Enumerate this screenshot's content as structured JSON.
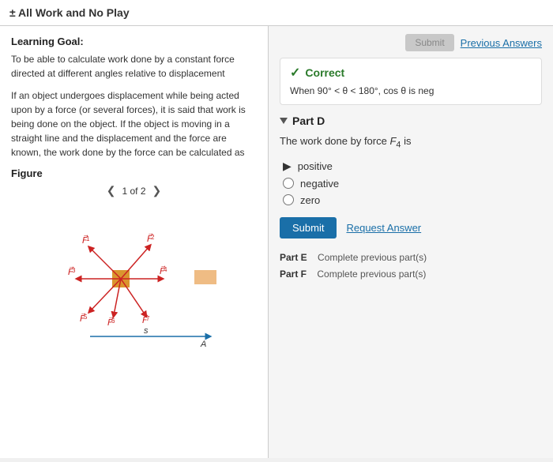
{
  "topBar": {
    "title": "± All Work and No Play"
  },
  "leftPanel": {
    "learningGoal": {
      "title": "Learning Goal:",
      "paragraph1": "To be able to calculate work done by a constant force directed at different angles relative to displacement",
      "paragraph2": "If an object undergoes displacement while being acted upon by a force (or several forces), it is said that work is being done on the object. If the object is moving in a straight line and the displacement and the force are known, the work done by the force can be calculated as"
    },
    "figure": {
      "label": "Figure",
      "nav": "1 of 2",
      "forces": [
        "F₁",
        "F₂",
        "F₃",
        "F₄",
        "F₅",
        "F₆",
        "F₇"
      ]
    }
  },
  "rightPanel": {
    "previousAnswers": {
      "submitLabel": "Submit",
      "linkLabel": "Previous Answers"
    },
    "correct": {
      "label": "Correct",
      "detail": "When 90° < θ < 180°, cos θ is neg"
    },
    "partD": {
      "label": "Part D",
      "question": "The work done by force F₄ is",
      "options": [
        {
          "id": "positive",
          "label": "positive",
          "selected": true
        },
        {
          "id": "negative",
          "label": "negative",
          "selected": false
        },
        {
          "id": "zero",
          "label": "zero",
          "selected": false
        }
      ],
      "submitLabel": "Submit",
      "requestAnswerLabel": "Request Answer"
    },
    "partE": {
      "label": "Part E",
      "text": "Complete previous part(s)"
    },
    "partF": {
      "label": "Part F",
      "text": "Complete previous part(s)"
    }
  }
}
